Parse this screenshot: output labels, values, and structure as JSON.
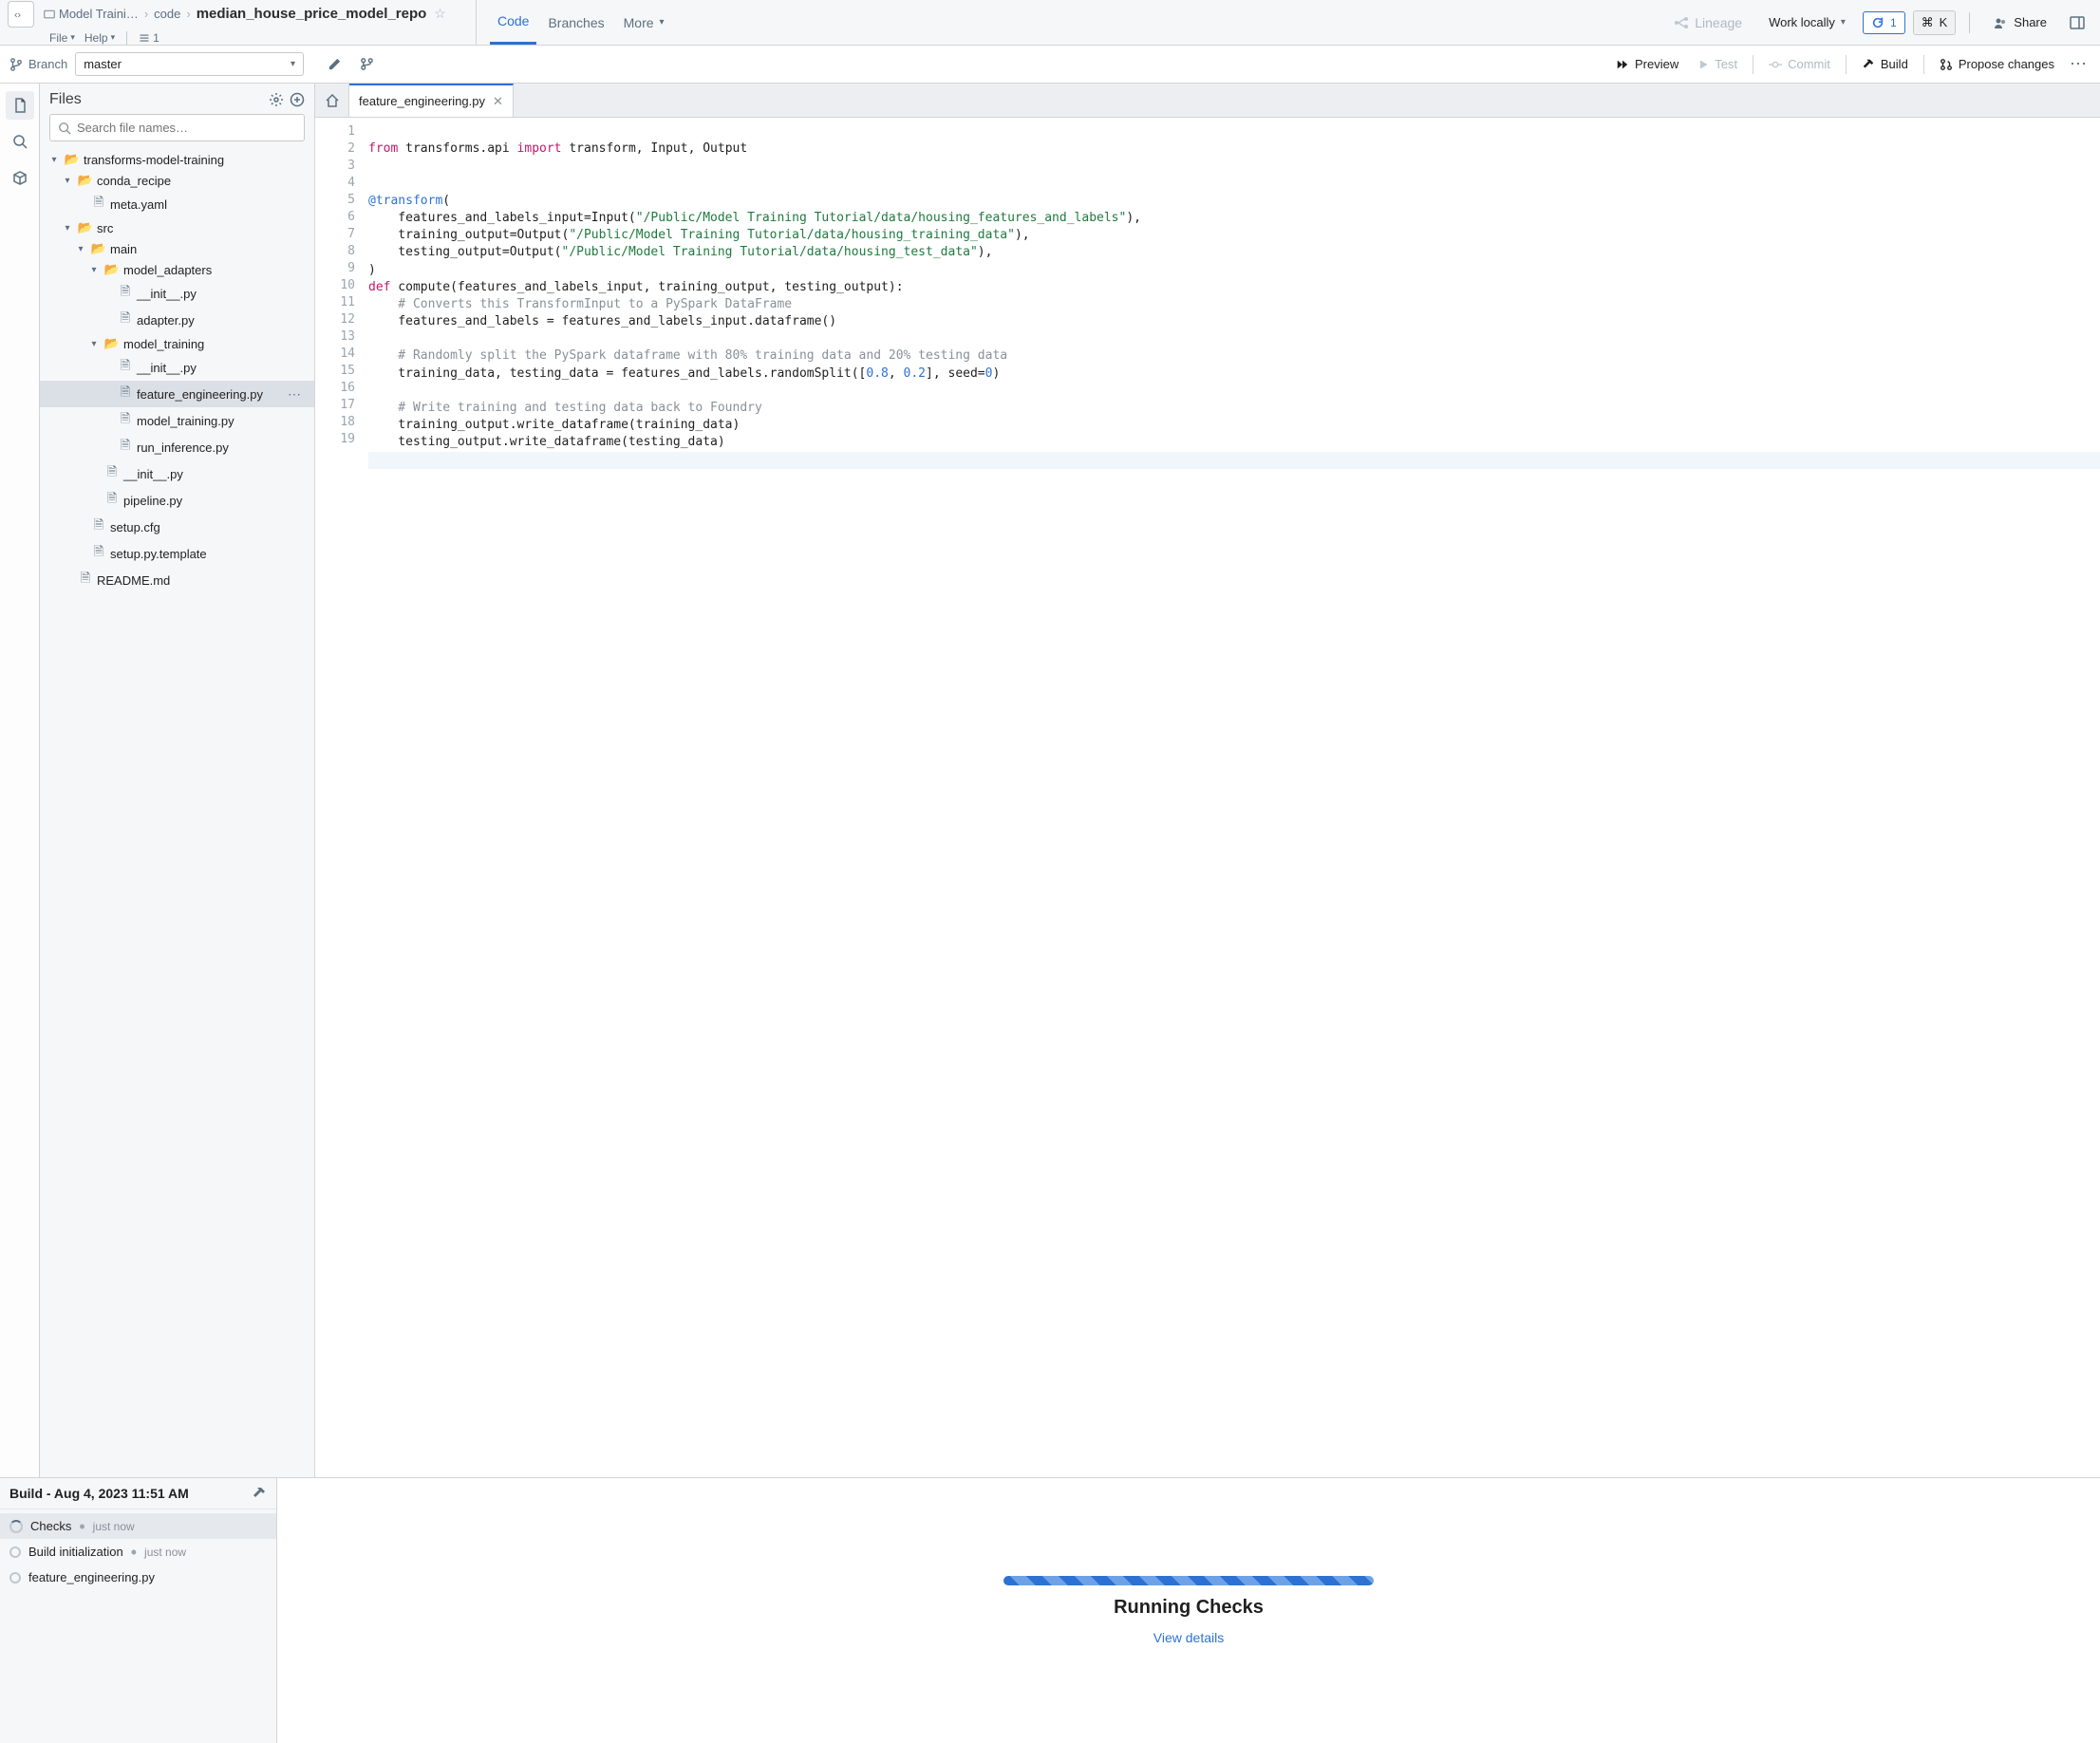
{
  "breadcrumb": {
    "project": "Model Traini…",
    "folder": "code",
    "repo": "median_house_price_model_repo"
  },
  "menubar": {
    "file": "File",
    "help": "Help",
    "changes_count": "1"
  },
  "nav": {
    "code": "Code",
    "branches": "Branches",
    "more": "More",
    "lineage": "Lineage",
    "work_locally": "Work locally",
    "refresh_badge": "1",
    "cmd_key": "K",
    "share": "Share"
  },
  "branch": {
    "label": "Branch",
    "value": "master"
  },
  "toolbar": {
    "preview": "Preview",
    "test": "Test",
    "commit": "Commit",
    "build": "Build",
    "propose": "Propose changes"
  },
  "sidebar": {
    "title": "Files",
    "search_placeholder": "Search file names…"
  },
  "tree": {
    "root": "transforms-model-training",
    "conda_recipe": "conda_recipe",
    "meta_yaml": "meta.yaml",
    "src": "src",
    "main": "main",
    "model_adapters": "model_adapters",
    "init1": "__init__.py",
    "adapter": "adapter.py",
    "model_training": "model_training",
    "init2": "__init__.py",
    "feature_engineering": "feature_engineering.py",
    "model_training_py": "model_training.py",
    "run_inference": "run_inference.py",
    "init3": "__init__.py",
    "pipeline": "pipeline.py",
    "setup_cfg": "setup.cfg",
    "setup_tmpl": "setup.py.template",
    "readme": "README.md"
  },
  "tab": {
    "name": "feature_engineering.py"
  },
  "code": {
    "l1a": "from",
    "l1b": " transforms.api ",
    "l1c": "import",
    "l1d": " transform, Input, Output",
    "l4a": "@transform",
    "l4b": "(",
    "l5a": "    features_and_labels_input=Input(",
    "l5b": "\"/Public/Model Training Tutorial/data/housing_features_and_labels\"",
    "l5c": "),",
    "l6a": "    training_output=Output(",
    "l6b": "\"/Public/Model Training Tutorial/data/housing_training_data\"",
    "l6c": "),",
    "l7a": "    testing_output=Output(",
    "l7b": "\"/Public/Model Training Tutorial/data/housing_test_data\"",
    "l7c": "),",
    "l8": ")",
    "l9a": "def",
    "l9b": " compute(features_and_labels_input, training_output, testing_output):",
    "l10": "    # Converts this TransformInput to a PySpark DataFrame",
    "l11": "    features_and_labels = features_and_labels_input.dataframe()",
    "l13": "    # Randomly split the PySpark dataframe with 80% training data and 20% testing data",
    "l14a": "    training_data, testing_data = features_and_labels.randomSplit([",
    "l14b": "0.8",
    "l14c": ", ",
    "l14d": "0.2",
    "l14e": "], seed=",
    "l14f": "0",
    "l14g": ")",
    "l16": "    # Write training and testing data back to Foundry",
    "l17": "    training_output.write_dataframe(training_data)",
    "l18": "    testing_output.write_dataframe(testing_data)"
  },
  "build": {
    "title": "Build - Aug 4, 2023 11:51 AM",
    "checks": "Checks",
    "just_now": "just now",
    "build_init": "Build initialization",
    "fe": "feature_engineering.py"
  },
  "status": {
    "title": "Running Checks",
    "link": "View details"
  }
}
